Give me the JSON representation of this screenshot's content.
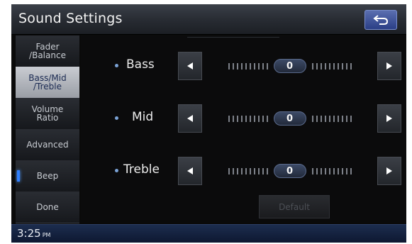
{
  "header": {
    "title": "Sound Settings",
    "back_icon": "back-arrow-icon"
  },
  "sidebar": {
    "items": [
      {
        "label": "Fader\n/Balance",
        "active": false
      },
      {
        "label": "Bass/Mid\n/Treble",
        "active": true
      },
      {
        "label": "Volume\nRatio",
        "active": false
      },
      {
        "label": "Advanced",
        "active": false
      },
      {
        "label": "Beep",
        "active": false,
        "indicator_on": true
      },
      {
        "label": "Done",
        "active": false
      }
    ]
  },
  "controls": [
    {
      "label": "Bass",
      "value": "0"
    },
    {
      "label": "Mid",
      "value": "0"
    },
    {
      "label": "Treble",
      "value": "0"
    }
  ],
  "default_button": {
    "label": "Default",
    "enabled": false
  },
  "status": {
    "time": "3:25",
    "ampm": "PM"
  },
  "colors": {
    "accent_blue": "#2f7fff",
    "active_tab": "#b4b8bf",
    "status_bar": "#1c2d4e"
  }
}
